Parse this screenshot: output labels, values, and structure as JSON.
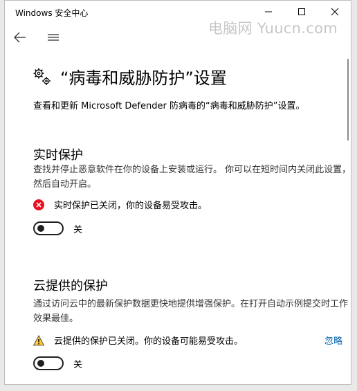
{
  "window": {
    "title": "Windows 安全中心"
  },
  "watermark": "电脑网 Yuucn.com",
  "page": {
    "heading": "“病毒和威胁防护”设置",
    "intro": "查看和更新 Microsoft Defender 防病毒的“病毒和威胁防护”设置。"
  },
  "realtime": {
    "title": "实时保护",
    "description": "查找并停止恶意软件在你的设备上安装或运行。 你可以在短时间内关闭此设置，然后自动开启。",
    "status": "实时保护已关闭，你的设备易受攻击。",
    "toggle_state": "关"
  },
  "cloud": {
    "title": "云提供的保护",
    "description": "通过访问云中的最新保护数据更快地提供增强保护。在打开自动示例提交时工作效果最佳。",
    "status": "云提供的保护已关闭。你的设备可能易受攻击。",
    "dismiss_label": "忽略",
    "toggle_state": "关"
  },
  "colors": {
    "error": "#e81123",
    "warning": "#ffc83d",
    "link": "#0063b1"
  }
}
